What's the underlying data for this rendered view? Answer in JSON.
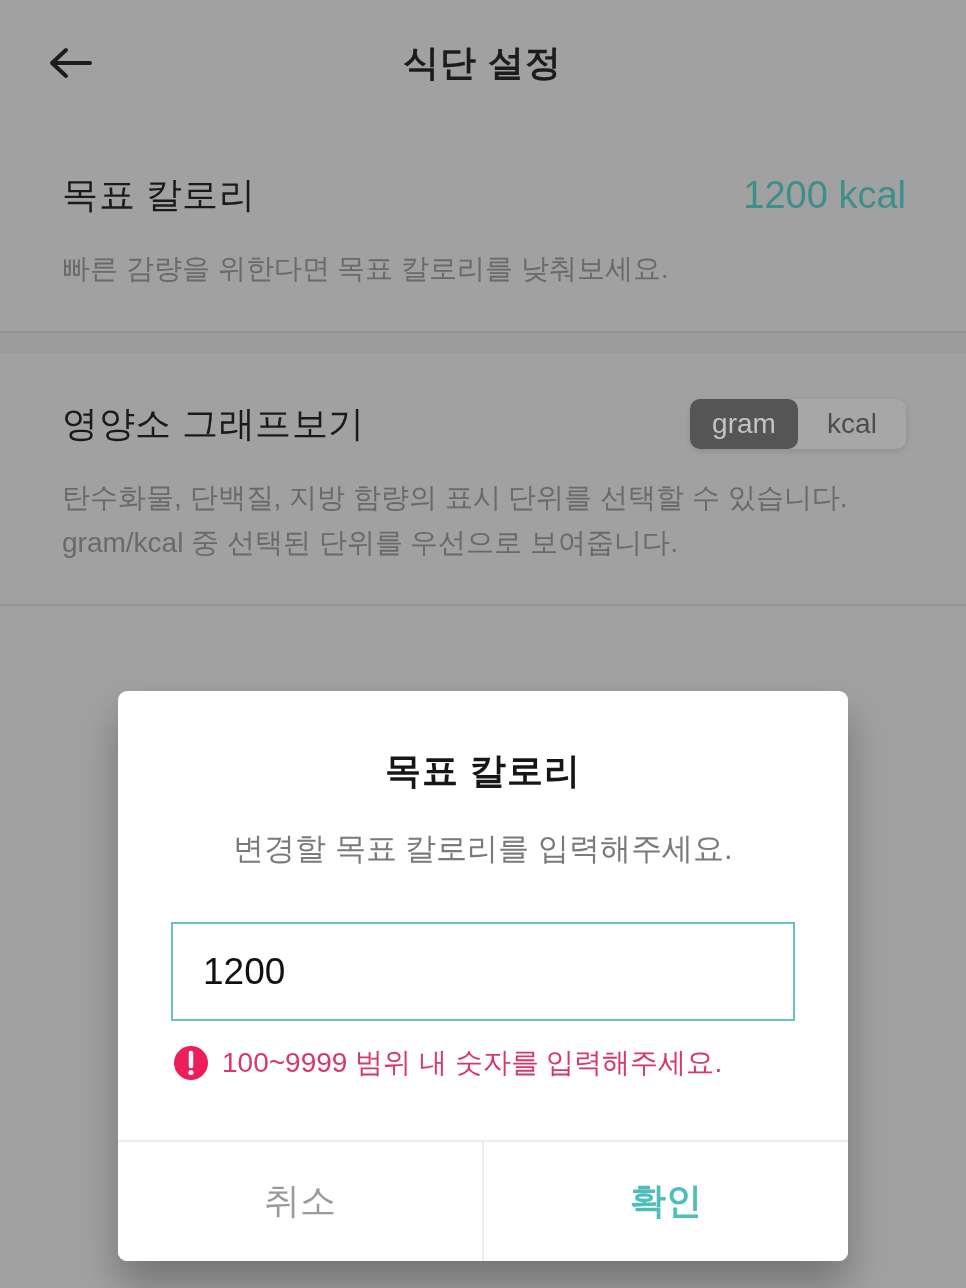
{
  "header": {
    "title": "식단 설정"
  },
  "settings": [
    {
      "kind": "value",
      "label": "목표 칼로리",
      "value": "1200 kcal",
      "description": "빠른 감량을 위한다면 목표 칼로리를 낮춰보세요."
    },
    {
      "kind": "toggle",
      "label": "영양소 그래프보기",
      "options": [
        {
          "label": "gram",
          "selected": true
        },
        {
          "label": "kcal",
          "selected": false
        }
      ],
      "description": "탄수화물, 단백질, 지방 함량의 표시 단위를 선택할 수 있습니다. gram/kcal 중 선택된 단위를 우선으로 보여줍니다."
    }
  ],
  "dialog": {
    "title": "목표 칼로리",
    "message": "변경할 목표 칼로리를 입력해주세요.",
    "input": {
      "value": "1200"
    },
    "error": "100~9999 범위 내 숫자를 입력해주세요.",
    "buttons": [
      {
        "kind": "cancel",
        "label": "취소"
      },
      {
        "kind": "confirm",
        "label": "확인"
      }
    ]
  }
}
